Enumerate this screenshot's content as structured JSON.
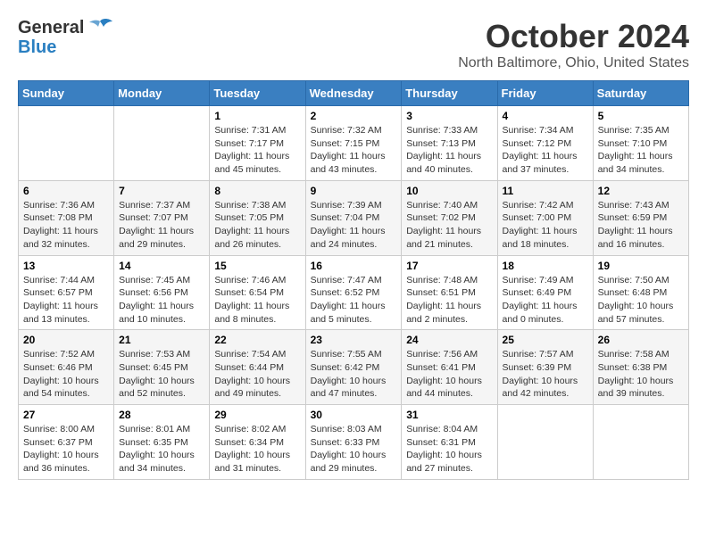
{
  "header": {
    "logo_line1": "General",
    "logo_line2": "Blue",
    "month": "October 2024",
    "location": "North Baltimore, Ohio, United States"
  },
  "weekdays": [
    "Sunday",
    "Monday",
    "Tuesday",
    "Wednesday",
    "Thursday",
    "Friday",
    "Saturday"
  ],
  "weeks": [
    [
      {
        "day": "",
        "info": ""
      },
      {
        "day": "",
        "info": ""
      },
      {
        "day": "1",
        "info": "Sunrise: 7:31 AM\nSunset: 7:17 PM\nDaylight: 11 hours and 45 minutes."
      },
      {
        "day": "2",
        "info": "Sunrise: 7:32 AM\nSunset: 7:15 PM\nDaylight: 11 hours and 43 minutes."
      },
      {
        "day": "3",
        "info": "Sunrise: 7:33 AM\nSunset: 7:13 PM\nDaylight: 11 hours and 40 minutes."
      },
      {
        "day": "4",
        "info": "Sunrise: 7:34 AM\nSunset: 7:12 PM\nDaylight: 11 hours and 37 minutes."
      },
      {
        "day": "5",
        "info": "Sunrise: 7:35 AM\nSunset: 7:10 PM\nDaylight: 11 hours and 34 minutes."
      }
    ],
    [
      {
        "day": "6",
        "info": "Sunrise: 7:36 AM\nSunset: 7:08 PM\nDaylight: 11 hours and 32 minutes."
      },
      {
        "day": "7",
        "info": "Sunrise: 7:37 AM\nSunset: 7:07 PM\nDaylight: 11 hours and 29 minutes."
      },
      {
        "day": "8",
        "info": "Sunrise: 7:38 AM\nSunset: 7:05 PM\nDaylight: 11 hours and 26 minutes."
      },
      {
        "day": "9",
        "info": "Sunrise: 7:39 AM\nSunset: 7:04 PM\nDaylight: 11 hours and 24 minutes."
      },
      {
        "day": "10",
        "info": "Sunrise: 7:40 AM\nSunset: 7:02 PM\nDaylight: 11 hours and 21 minutes."
      },
      {
        "day": "11",
        "info": "Sunrise: 7:42 AM\nSunset: 7:00 PM\nDaylight: 11 hours and 18 minutes."
      },
      {
        "day": "12",
        "info": "Sunrise: 7:43 AM\nSunset: 6:59 PM\nDaylight: 11 hours and 16 minutes."
      }
    ],
    [
      {
        "day": "13",
        "info": "Sunrise: 7:44 AM\nSunset: 6:57 PM\nDaylight: 11 hours and 13 minutes."
      },
      {
        "day": "14",
        "info": "Sunrise: 7:45 AM\nSunset: 6:56 PM\nDaylight: 11 hours and 10 minutes."
      },
      {
        "day": "15",
        "info": "Sunrise: 7:46 AM\nSunset: 6:54 PM\nDaylight: 11 hours and 8 minutes."
      },
      {
        "day": "16",
        "info": "Sunrise: 7:47 AM\nSunset: 6:52 PM\nDaylight: 11 hours and 5 minutes."
      },
      {
        "day": "17",
        "info": "Sunrise: 7:48 AM\nSunset: 6:51 PM\nDaylight: 11 hours and 2 minutes."
      },
      {
        "day": "18",
        "info": "Sunrise: 7:49 AM\nSunset: 6:49 PM\nDaylight: 11 hours and 0 minutes."
      },
      {
        "day": "19",
        "info": "Sunrise: 7:50 AM\nSunset: 6:48 PM\nDaylight: 10 hours and 57 minutes."
      }
    ],
    [
      {
        "day": "20",
        "info": "Sunrise: 7:52 AM\nSunset: 6:46 PM\nDaylight: 10 hours and 54 minutes."
      },
      {
        "day": "21",
        "info": "Sunrise: 7:53 AM\nSunset: 6:45 PM\nDaylight: 10 hours and 52 minutes."
      },
      {
        "day": "22",
        "info": "Sunrise: 7:54 AM\nSunset: 6:44 PM\nDaylight: 10 hours and 49 minutes."
      },
      {
        "day": "23",
        "info": "Sunrise: 7:55 AM\nSunset: 6:42 PM\nDaylight: 10 hours and 47 minutes."
      },
      {
        "day": "24",
        "info": "Sunrise: 7:56 AM\nSunset: 6:41 PM\nDaylight: 10 hours and 44 minutes."
      },
      {
        "day": "25",
        "info": "Sunrise: 7:57 AM\nSunset: 6:39 PM\nDaylight: 10 hours and 42 minutes."
      },
      {
        "day": "26",
        "info": "Sunrise: 7:58 AM\nSunset: 6:38 PM\nDaylight: 10 hours and 39 minutes."
      }
    ],
    [
      {
        "day": "27",
        "info": "Sunrise: 8:00 AM\nSunset: 6:37 PM\nDaylight: 10 hours and 36 minutes."
      },
      {
        "day": "28",
        "info": "Sunrise: 8:01 AM\nSunset: 6:35 PM\nDaylight: 10 hours and 34 minutes."
      },
      {
        "day": "29",
        "info": "Sunrise: 8:02 AM\nSunset: 6:34 PM\nDaylight: 10 hours and 31 minutes."
      },
      {
        "day": "30",
        "info": "Sunrise: 8:03 AM\nSunset: 6:33 PM\nDaylight: 10 hours and 29 minutes."
      },
      {
        "day": "31",
        "info": "Sunrise: 8:04 AM\nSunset: 6:31 PM\nDaylight: 10 hours and 27 minutes."
      },
      {
        "day": "",
        "info": ""
      },
      {
        "day": "",
        "info": ""
      }
    ]
  ]
}
